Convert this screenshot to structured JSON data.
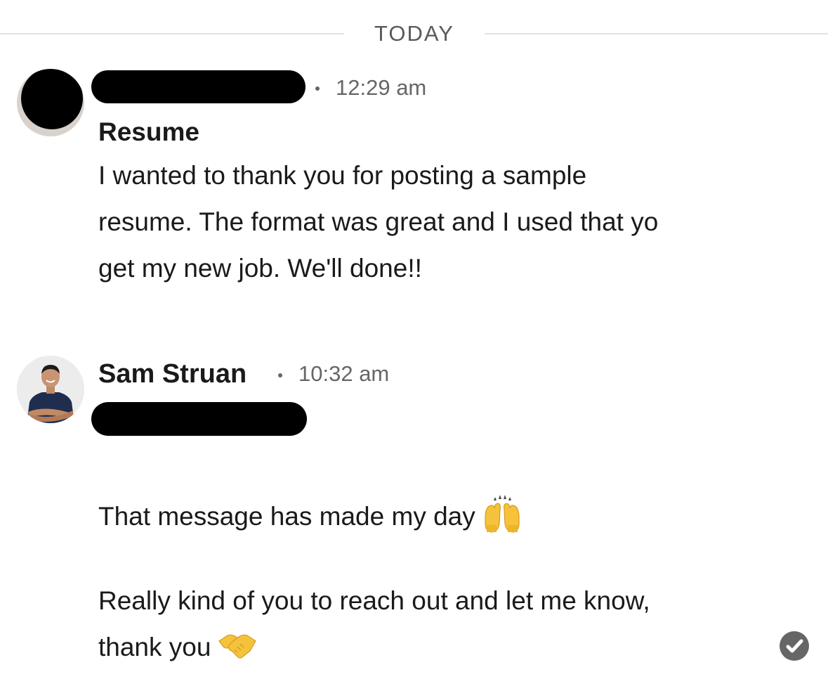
{
  "divider": {
    "label": "TODAY"
  },
  "messages": [
    {
      "sender_name": "",
      "sender_redacted": true,
      "time": "12:29 am",
      "subject": "Resume",
      "body_lines": [
        "I wanted to thank you for posting a sample",
        "resume. The format was great and I used that yo",
        "get my new job. We'll done!!"
      ]
    },
    {
      "sender_name": "Sam Struan",
      "time": "10:32 am",
      "subtitle_redacted": true,
      "body_lines": [
        "That message has made my day",
        "Really kind of you to reach out and let me know,",
        "thank you"
      ],
      "emojis": [
        "raising-hands-icon",
        "handshake-icon"
      ],
      "read_receipt": "check-circle-icon"
    }
  ],
  "colors": {
    "text": "#1a1a1a",
    "muted": "#666666",
    "divider": "#e2e2e2",
    "redaction": "#000000",
    "emoji_yellow": "#f5c33b"
  }
}
